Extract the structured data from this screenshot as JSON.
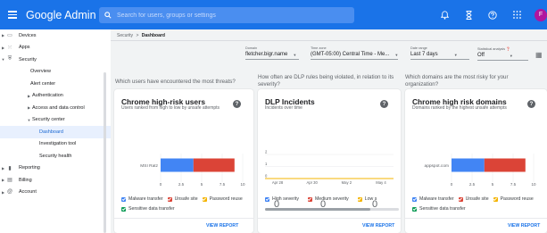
{
  "topbar": {
    "brand": "Google Admin",
    "search_placeholder": "Search for users, groups or settings",
    "avatar_letter": "F"
  },
  "sidebar": {
    "items": [
      {
        "label": "Devices"
      },
      {
        "label": "Apps"
      },
      {
        "label": "Security"
      },
      {
        "label": "Overview"
      },
      {
        "label": "Alert center"
      },
      {
        "label": "Authentication"
      },
      {
        "label": "Access and data control"
      },
      {
        "label": "Security center"
      },
      {
        "label": "Dashboard"
      },
      {
        "label": "Investigation tool"
      },
      {
        "label": "Security health"
      },
      {
        "label": "Reporting"
      },
      {
        "label": "Billing"
      },
      {
        "label": "Account"
      }
    ]
  },
  "breadcrumb": {
    "parent": "Security",
    "sep": ">",
    "current": "Dashboard"
  },
  "filters": {
    "domain": {
      "label": "Domain",
      "value": "fletcher.bigr.name"
    },
    "timezone": {
      "label": "Time zone",
      "value": "(GMT-05:00) Central Time - Me..."
    },
    "date_range": {
      "label": "Date range",
      "value": "Last 7 days"
    },
    "stat_analysis": {
      "label": "Statistical analysis",
      "value": "Off"
    }
  },
  "questions": {
    "q1": "Which users have encountered the most threats?",
    "q2": "How often are DLP rules being violated, in relation to its severity?",
    "q3": "Which domains are the most risky for your organization?"
  },
  "cards": {
    "users": {
      "title": "Chrome high-risk users",
      "subtitle": "Users ranked from high to low by unsafe attempts",
      "legend": [
        "Malware transfer",
        "Unsafe site",
        "Password reuse",
        "Sensitive data transfer"
      ],
      "view_report": "VIEW REPORT"
    },
    "dlp": {
      "title": "DLP Incidents",
      "subtitle": "Incidents over time",
      "legend": [
        "High severity",
        "Medium severity",
        "Low s"
      ],
      "legend_counts": [
        "0",
        "0",
        "0"
      ],
      "view_report": "VIEW REPORT"
    },
    "domains": {
      "title": "Chrome high risk domains",
      "subtitle": "Domains ranked by the highest unsafe attempts",
      "legend": [
        "Malware transfer",
        "Unsafe site",
        "Password reuse",
        "Sensitive data transfer"
      ],
      "view_report": "VIEW REPORT"
    }
  },
  "colors": {
    "blue": "#4285f4",
    "red": "#db4437",
    "yellow": "#f4b400",
    "green": "#0f9d58",
    "accent": "#1a73e8"
  },
  "chart_data": [
    {
      "type": "bar",
      "orientation": "horizontal",
      "stacked": true,
      "categories": [
        "MSI Ratz"
      ],
      "series": [
        {
          "name": "Malware transfer",
          "values": [
            4
          ]
        },
        {
          "name": "Unsafe site",
          "values": [
            5
          ]
        },
        {
          "name": "Password reuse",
          "values": [
            0
          ]
        },
        {
          "name": "Sensitive data transfer",
          "values": [
            0
          ]
        }
      ],
      "xlim": [
        0,
        10
      ],
      "xticks": [
        "0",
        "2.5",
        "5",
        "7.5",
        "10"
      ]
    },
    {
      "type": "line",
      "categories": [
        "Apr 28",
        "Apr 30",
        "May 2",
        "May 4"
      ],
      "series": [
        {
          "name": "High severity",
          "values": [
            0,
            0,
            0,
            0
          ]
        },
        {
          "name": "Medium severity",
          "values": [
            0,
            0,
            0,
            0
          ]
        },
        {
          "name": "Low s",
          "values": [
            0,
            0,
            0,
            0
          ]
        }
      ],
      "ylim": [
        0,
        2
      ],
      "yticks": [
        "0",
        "1",
        "2"
      ]
    },
    {
      "type": "bar",
      "orientation": "horizontal",
      "stacked": true,
      "categories": [
        "appspot.com"
      ],
      "series": [
        {
          "name": "Malware transfer",
          "values": [
            4
          ]
        },
        {
          "name": "Unsafe site",
          "values": [
            5
          ]
        },
        {
          "name": "Password reuse",
          "values": [
            0
          ]
        },
        {
          "name": "Sensitive data transfer",
          "values": [
            0
          ]
        }
      ],
      "xlim": [
        0,
        10
      ],
      "xticks": [
        "0",
        "2.5",
        "5",
        "7.5",
        "10"
      ]
    }
  ]
}
